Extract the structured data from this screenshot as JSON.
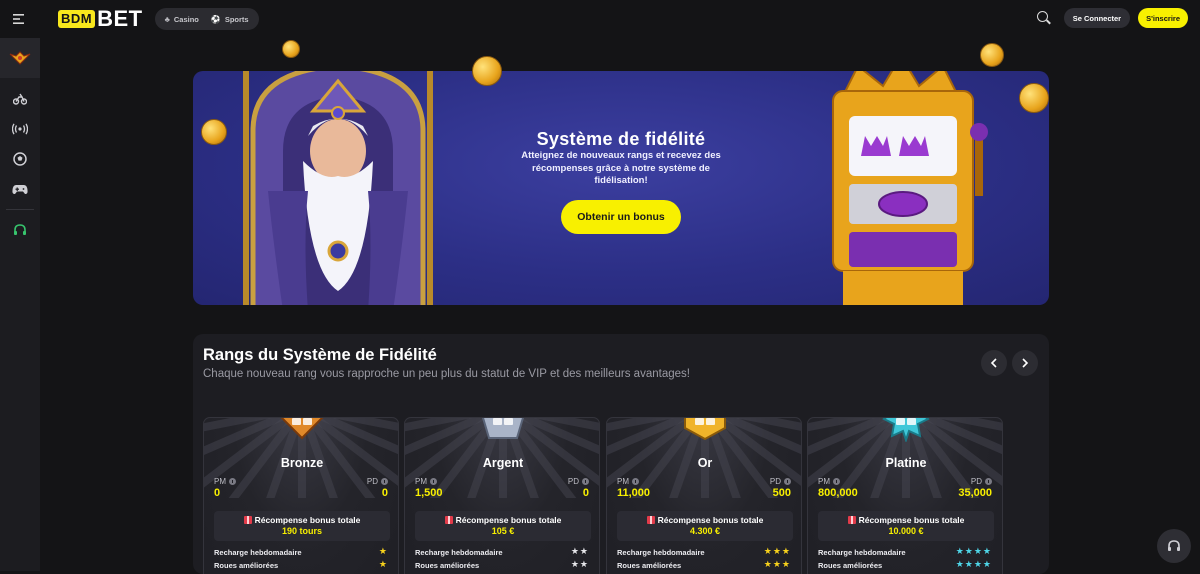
{
  "header": {
    "logo_box": "BDM",
    "logo_text": "BET",
    "modes": [
      {
        "label": "Casino",
        "icon": "dice-icon"
      },
      {
        "label": "Sports",
        "icon": "soccer-ball-icon"
      }
    ],
    "login_label": "Se Connecter",
    "signup_label": "S'inscrire"
  },
  "sidebar": {
    "items": [
      {
        "name": "vip-crown-icon"
      },
      {
        "name": "motorbike-icon"
      },
      {
        "name": "live-broadcast-icon"
      },
      {
        "name": "soccer-ball-icon"
      },
      {
        "name": "gamepad-icon"
      },
      {
        "name": "headset-icon"
      }
    ]
  },
  "banner": {
    "title": "Système de fidélité",
    "subtitle": "Atteignez de nouveaux rangs et recevez des récompenses grâce à notre système de fidélisation!",
    "button_label": "Obtenir un bonus"
  },
  "ranks": {
    "title": "Rangs du Système de Fidélité",
    "subtitle": "Chaque nouveau rang vous rapproche un peu plus du statut de VIP et des meilleurs avantages!",
    "pm_label": "PM",
    "pd_label": "PD",
    "bonus_label": "Récompense bonus totale",
    "feature_1": "Recharge hebdomadaire",
    "feature_2": "Roues améliorées",
    "cards": [
      {
        "name": "Bronze",
        "pm": "0",
        "pd": "0",
        "bonus": "190 tours",
        "stars": 1,
        "star_color": "#f8d21c",
        "icon_color": "#e0892a"
      },
      {
        "name": "Argent",
        "pm": "1,500",
        "pd": "0",
        "bonus": "105 €",
        "stars": 2,
        "star_color": "#e6e6ea",
        "icon_color": "#a9b4c8"
      },
      {
        "name": "Or",
        "pm": "11,000",
        "pd": "500",
        "bonus": "4.300 €",
        "stars": 3,
        "star_color": "#f8d21c",
        "icon_color": "#f0b42a"
      },
      {
        "name": "Platine",
        "pm": "800,000",
        "pd": "35,000",
        "bonus": "10.000 €",
        "stars": 4,
        "star_color": "#4fd6e8",
        "icon_color": "#3fc7d8"
      }
    ]
  }
}
